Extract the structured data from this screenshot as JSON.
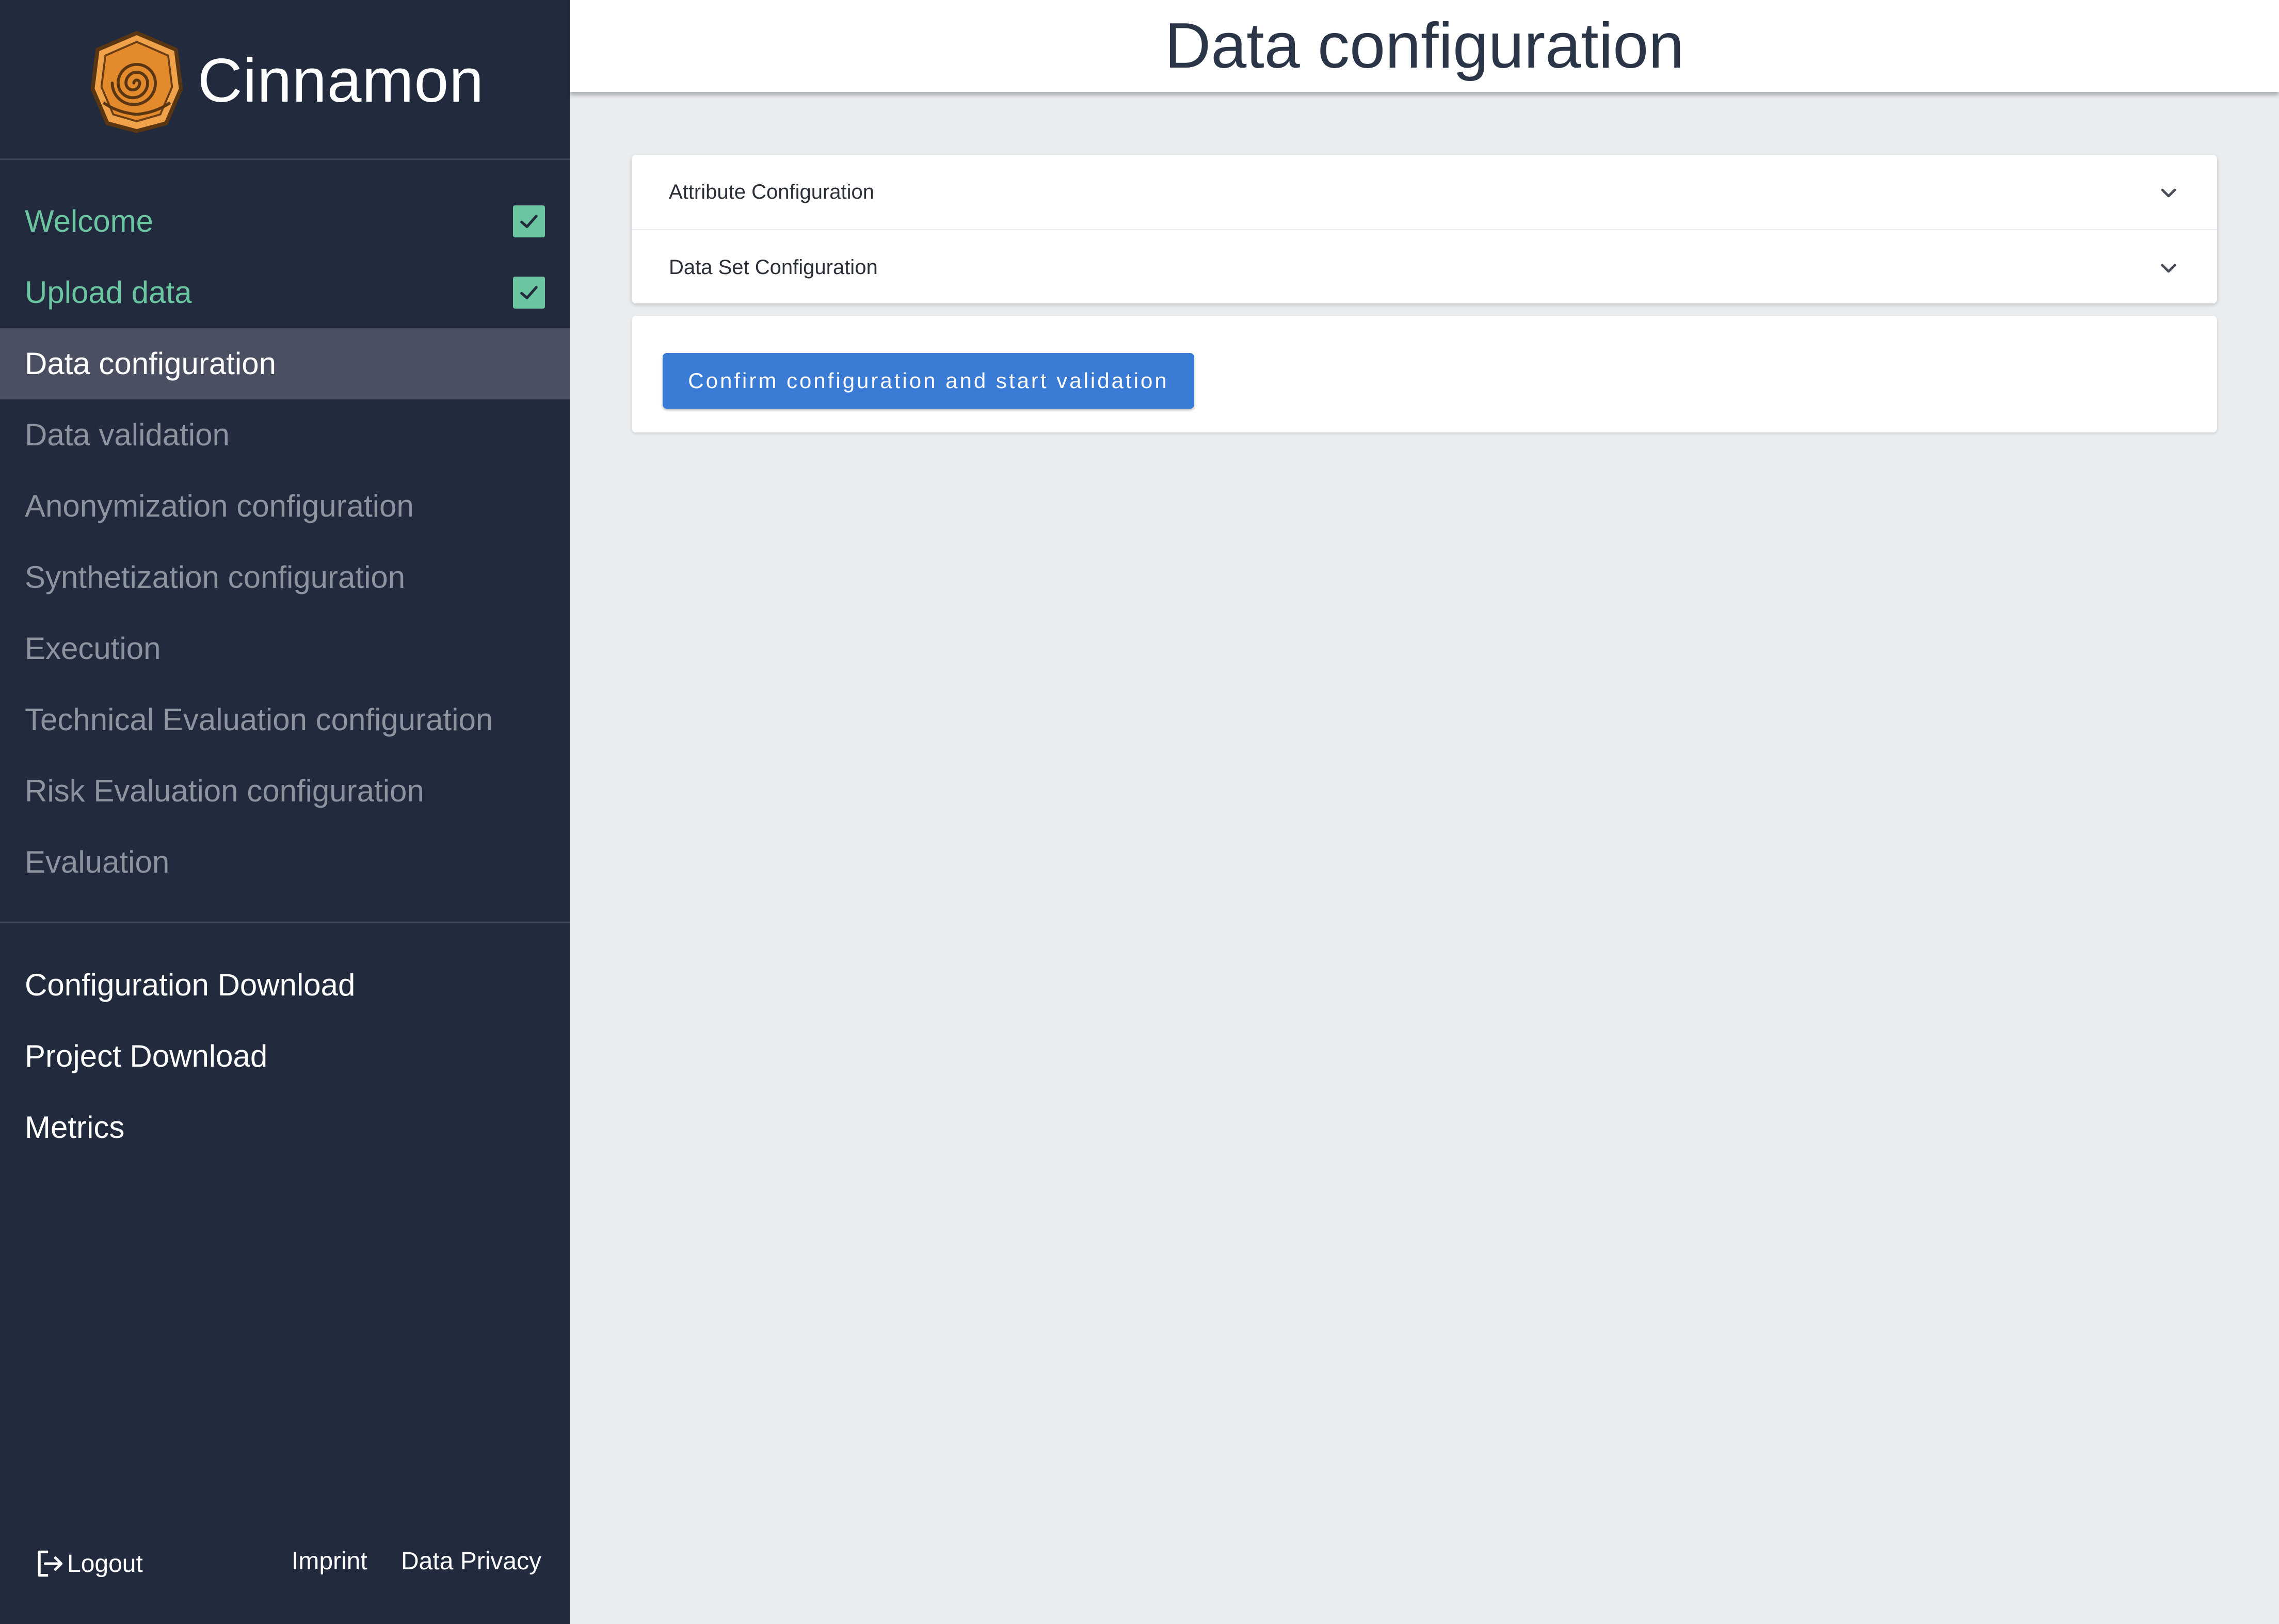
{
  "app": {
    "name": "Cinnamon",
    "logo_icon": "cinnamon-roll-logo-icon"
  },
  "header": {
    "title": "Data configuration"
  },
  "sidebar": {
    "steps": [
      {
        "label": "Welcome",
        "state": "done"
      },
      {
        "label": "Upload data",
        "state": "done"
      },
      {
        "label": "Data configuration",
        "state": "active"
      },
      {
        "label": "Data validation",
        "state": "pending"
      },
      {
        "label": "Anonymization configuration",
        "state": "pending"
      },
      {
        "label": "Synthetization configuration",
        "state": "pending"
      },
      {
        "label": "Execution",
        "state": "pending"
      },
      {
        "label": "Technical Evaluation configuration",
        "state": "pending"
      },
      {
        "label": "Risk Evaluation configuration",
        "state": "pending"
      },
      {
        "label": "Evaluation",
        "state": "pending"
      }
    ],
    "links": [
      {
        "label": "Configuration Download"
      },
      {
        "label": "Project Download"
      },
      {
        "label": "Metrics"
      }
    ],
    "footer": {
      "logout_label": "Logout",
      "imprint_label": "Imprint",
      "privacy_label": "Data Privacy"
    }
  },
  "main": {
    "panels": [
      {
        "label": "Attribute Configuration"
      },
      {
        "label": "Data Set Configuration"
      }
    ],
    "confirm_button_label": "Confirm configuration and start validation"
  },
  "colors": {
    "sidebar_bg": "#222a3e",
    "active_item_bg": "#4a4f62",
    "done_green": "#6cc5a1",
    "pending_gray": "#8e949f",
    "primary_button": "#3a7bd5",
    "content_bg": "#eaedf0"
  }
}
